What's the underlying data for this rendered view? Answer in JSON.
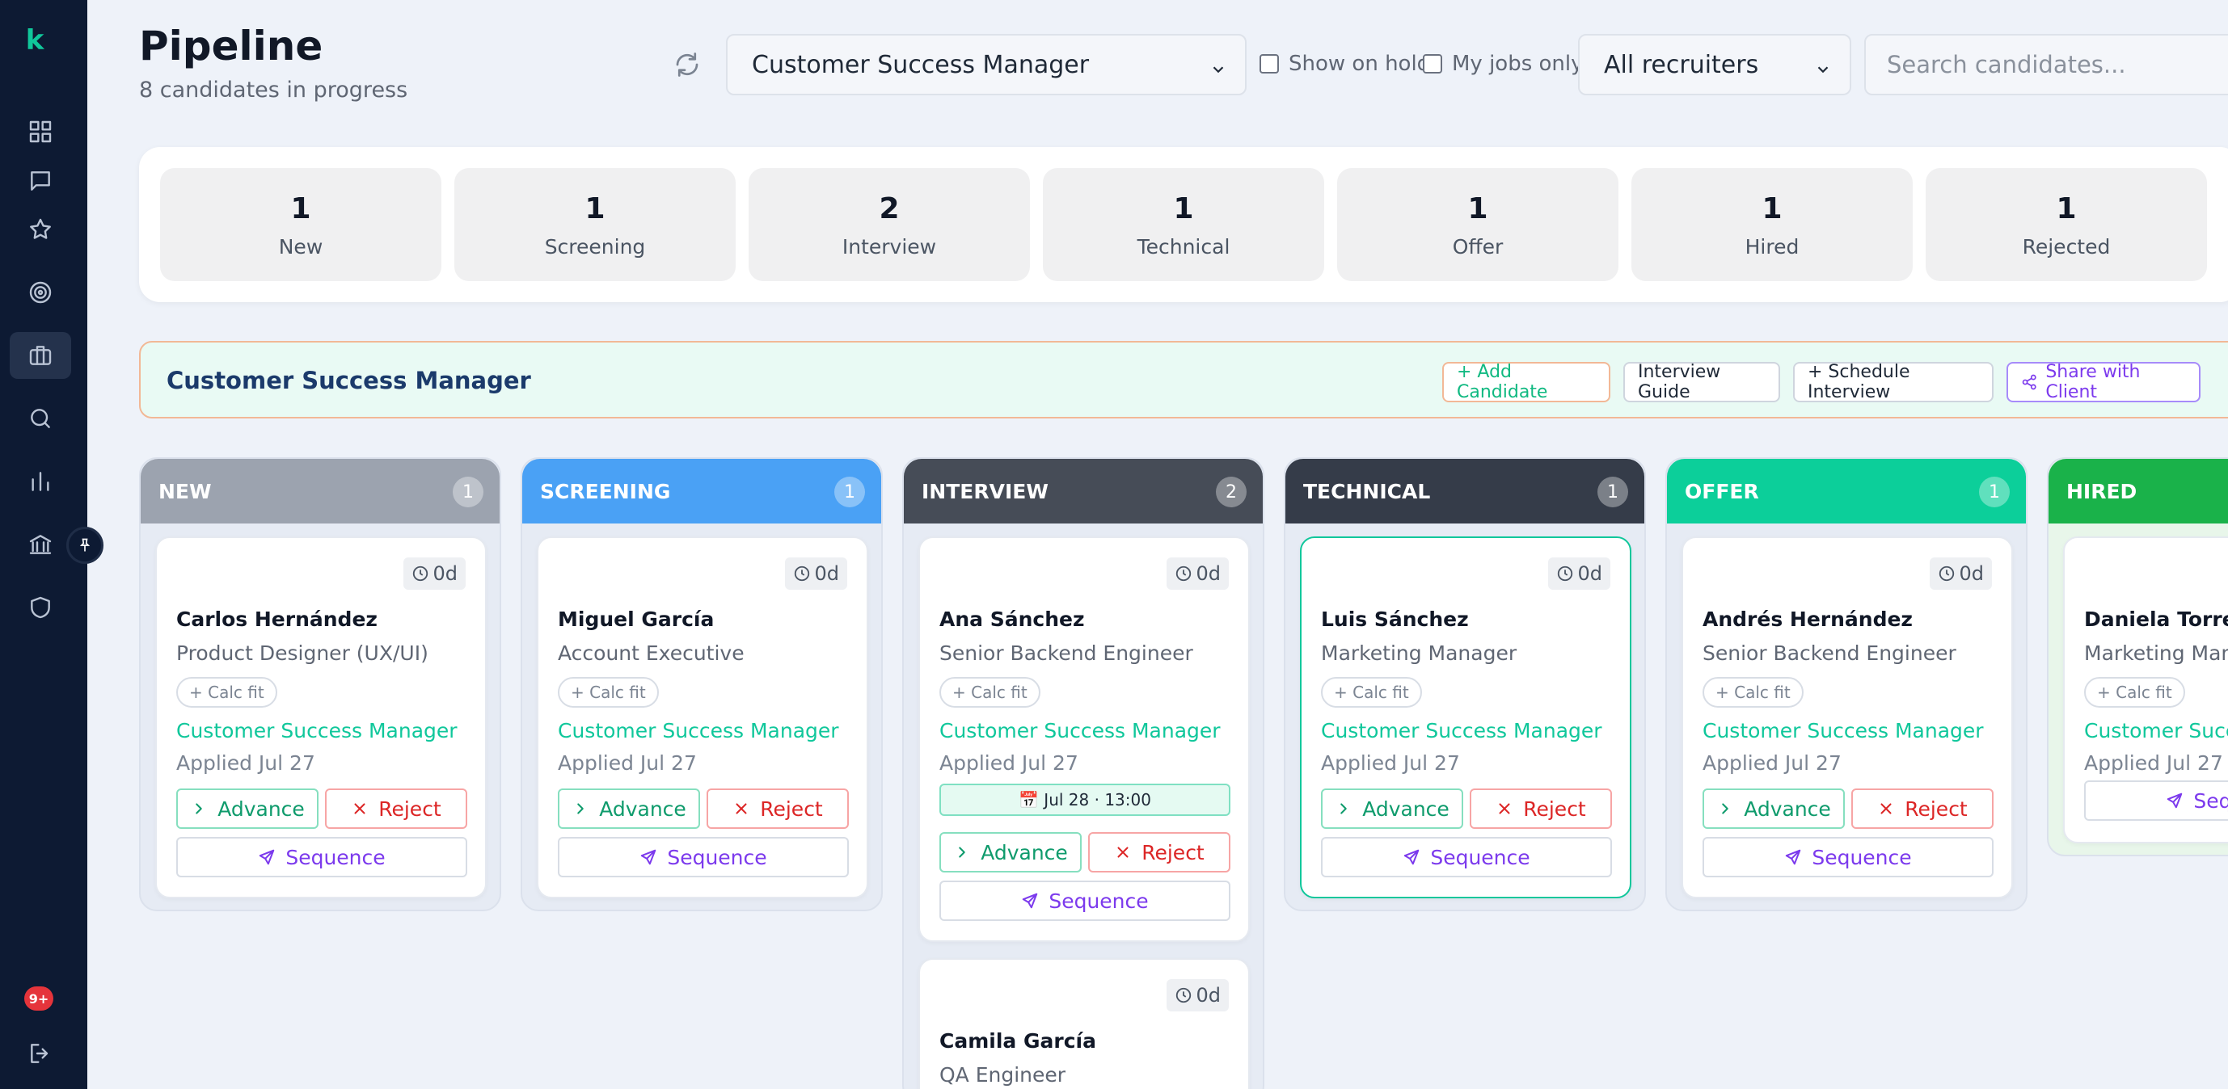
{
  "app": {
    "logo": "k",
    "notifications": "9+"
  },
  "header": {
    "title": "Pipeline",
    "subtitle": "8 candidates in progress",
    "job_filter": "Customer Success Manager",
    "show_on_hold": "Show on hold",
    "my_jobs_only": "My jobs only",
    "recruiter_filter": "All recruiters",
    "search_placeholder": "Search candidates..."
  },
  "stats": [
    {
      "count": "1",
      "label": "New"
    },
    {
      "count": "1",
      "label": "Screening"
    },
    {
      "count": "2",
      "label": "Interview"
    },
    {
      "count": "1",
      "label": "Technical"
    },
    {
      "count": "1",
      "label": "Offer"
    },
    {
      "count": "1",
      "label": "Hired"
    },
    {
      "count": "1",
      "label": "Rejected"
    }
  ],
  "job": {
    "title": "Customer Success Manager",
    "add_candidate": "+ Add Candidate",
    "interview_guide": "Interview Guide",
    "schedule_interview": "+ Schedule Interview",
    "share_with_client": "Share with Client"
  },
  "columns": [
    {
      "name": "NEW",
      "count": "1",
      "color": "#9ca3af"
    },
    {
      "name": "SCREENING",
      "count": "1",
      "color": "#4aa1f5"
    },
    {
      "name": "INTERVIEW",
      "count": "2",
      "color": "#464c57"
    },
    {
      "name": "TECHNICAL",
      "count": "1",
      "color": "#353c49"
    },
    {
      "name": "OFFER",
      "count": "1",
      "color": "#0ccf9a"
    },
    {
      "name": "HIRED",
      "count": "",
      "color": "#1ab24a"
    }
  ],
  "cards": [
    {
      "age": "0d",
      "name": "Carlos Hernández",
      "role": "Product Designer (UX/UI)",
      "fit": "+ Calc fit",
      "job": "Customer Success Manager",
      "applied": "Applied Jul 27",
      "advance": "Advance",
      "reject": "Reject",
      "sequence": "Sequence"
    },
    {
      "age": "0d",
      "name": "Miguel García",
      "role": "Account Executive",
      "fit": "+ Calc fit",
      "job": "Customer Success Manager",
      "applied": "Applied Jul 27",
      "advance": "Advance",
      "reject": "Reject",
      "sequence": "Sequence"
    },
    {
      "age": "0d",
      "name": "Ana Sánchez",
      "role": "Senior Backend Engineer",
      "fit": "+ Calc fit",
      "job": "Customer Success Manager",
      "applied": "Applied Jul 27",
      "interview": "📅 Jul 28 · 13:00",
      "advance": "Advance",
      "reject": "Reject",
      "sequence": "Sequence"
    },
    {
      "age": "0d",
      "name": "Camila García",
      "role": "QA Engineer"
    },
    {
      "age": "0d",
      "name": "Luis Sánchez",
      "role": "Marketing Manager",
      "fit": "+ Calc fit",
      "job": "Customer Success Manager",
      "applied": "Applied Jul 27",
      "advance": "Advance",
      "reject": "Reject",
      "sequence": "Sequence"
    },
    {
      "age": "0d",
      "name": "Andrés Hernández",
      "role": "Senior Backend Engineer",
      "fit": "+ Calc fit",
      "job": "Customer Success Manager",
      "applied": "Applied Jul 27",
      "advance": "Advance",
      "reject": "Reject",
      "sequence": "Sequence"
    },
    {
      "name": "Daniela Torres",
      "role": "Marketing Manager",
      "fit": "+ Calc fit",
      "job": "Customer Success Manager",
      "applied": "Applied Jul 27",
      "sequence": "Sequence"
    }
  ]
}
